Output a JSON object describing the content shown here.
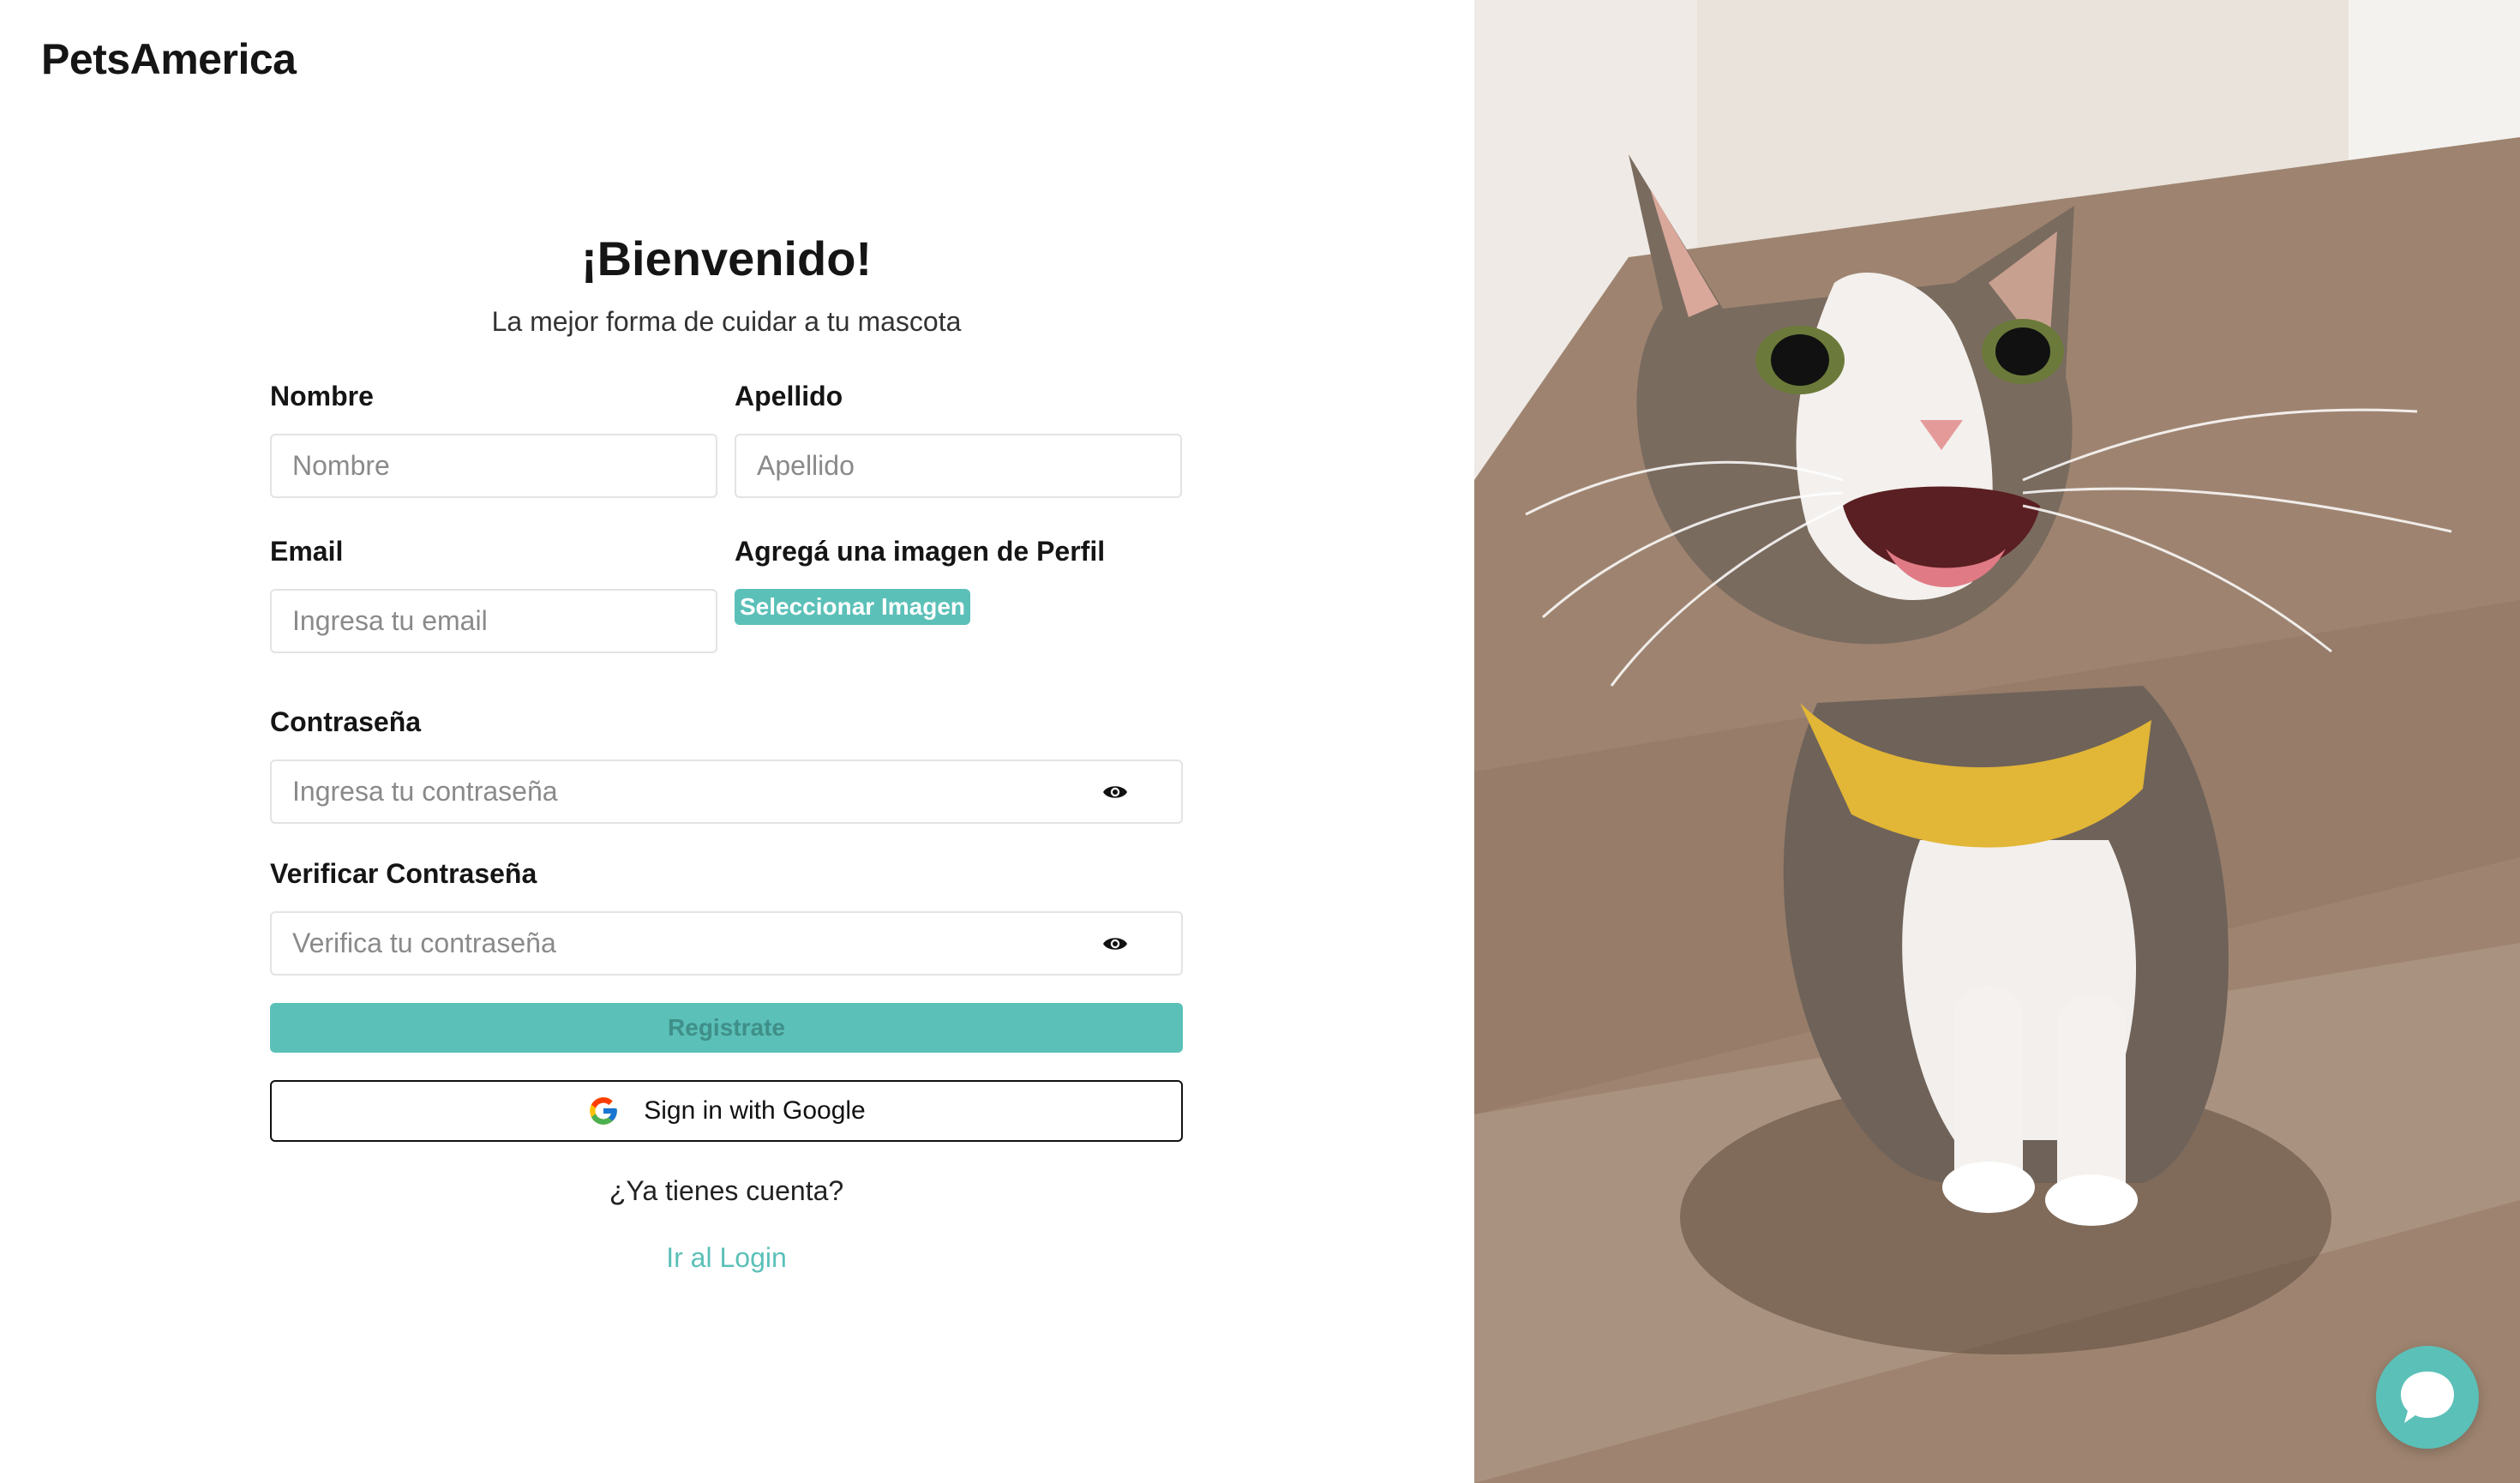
{
  "brand": "PetsAmerica",
  "title": "¡Bienvenido!",
  "subtitle": "La mejor forma de cuidar a tu mascota",
  "fields": {
    "nombre": {
      "label": "Nombre",
      "placeholder": "Nombre"
    },
    "apellido": {
      "label": "Apellido",
      "placeholder": "Apellido"
    },
    "email": {
      "label": "Email",
      "placeholder": "Ingresa tu email"
    },
    "imagen": {
      "label": "Agregá una imagen de Perfil",
      "button": "Seleccionar Imagen"
    },
    "password": {
      "label": "Contraseña",
      "placeholder": "Ingresa tu contraseña"
    },
    "verify": {
      "label": "Verificar Contraseña",
      "placeholder": "Verifica tu contraseña"
    }
  },
  "register_button": "Registrate",
  "google_button": "Sign in with Google",
  "have_account": "¿Ya tienes cuenta?",
  "login_link": "Ir al Login",
  "colors": {
    "accent": "#5bc0b8",
    "text": "#151515",
    "placeholder": "#8a8a8a"
  },
  "icons": {
    "eye": "eye-icon",
    "google": "google-logo-icon",
    "chat": "chat-bubble-icon"
  }
}
